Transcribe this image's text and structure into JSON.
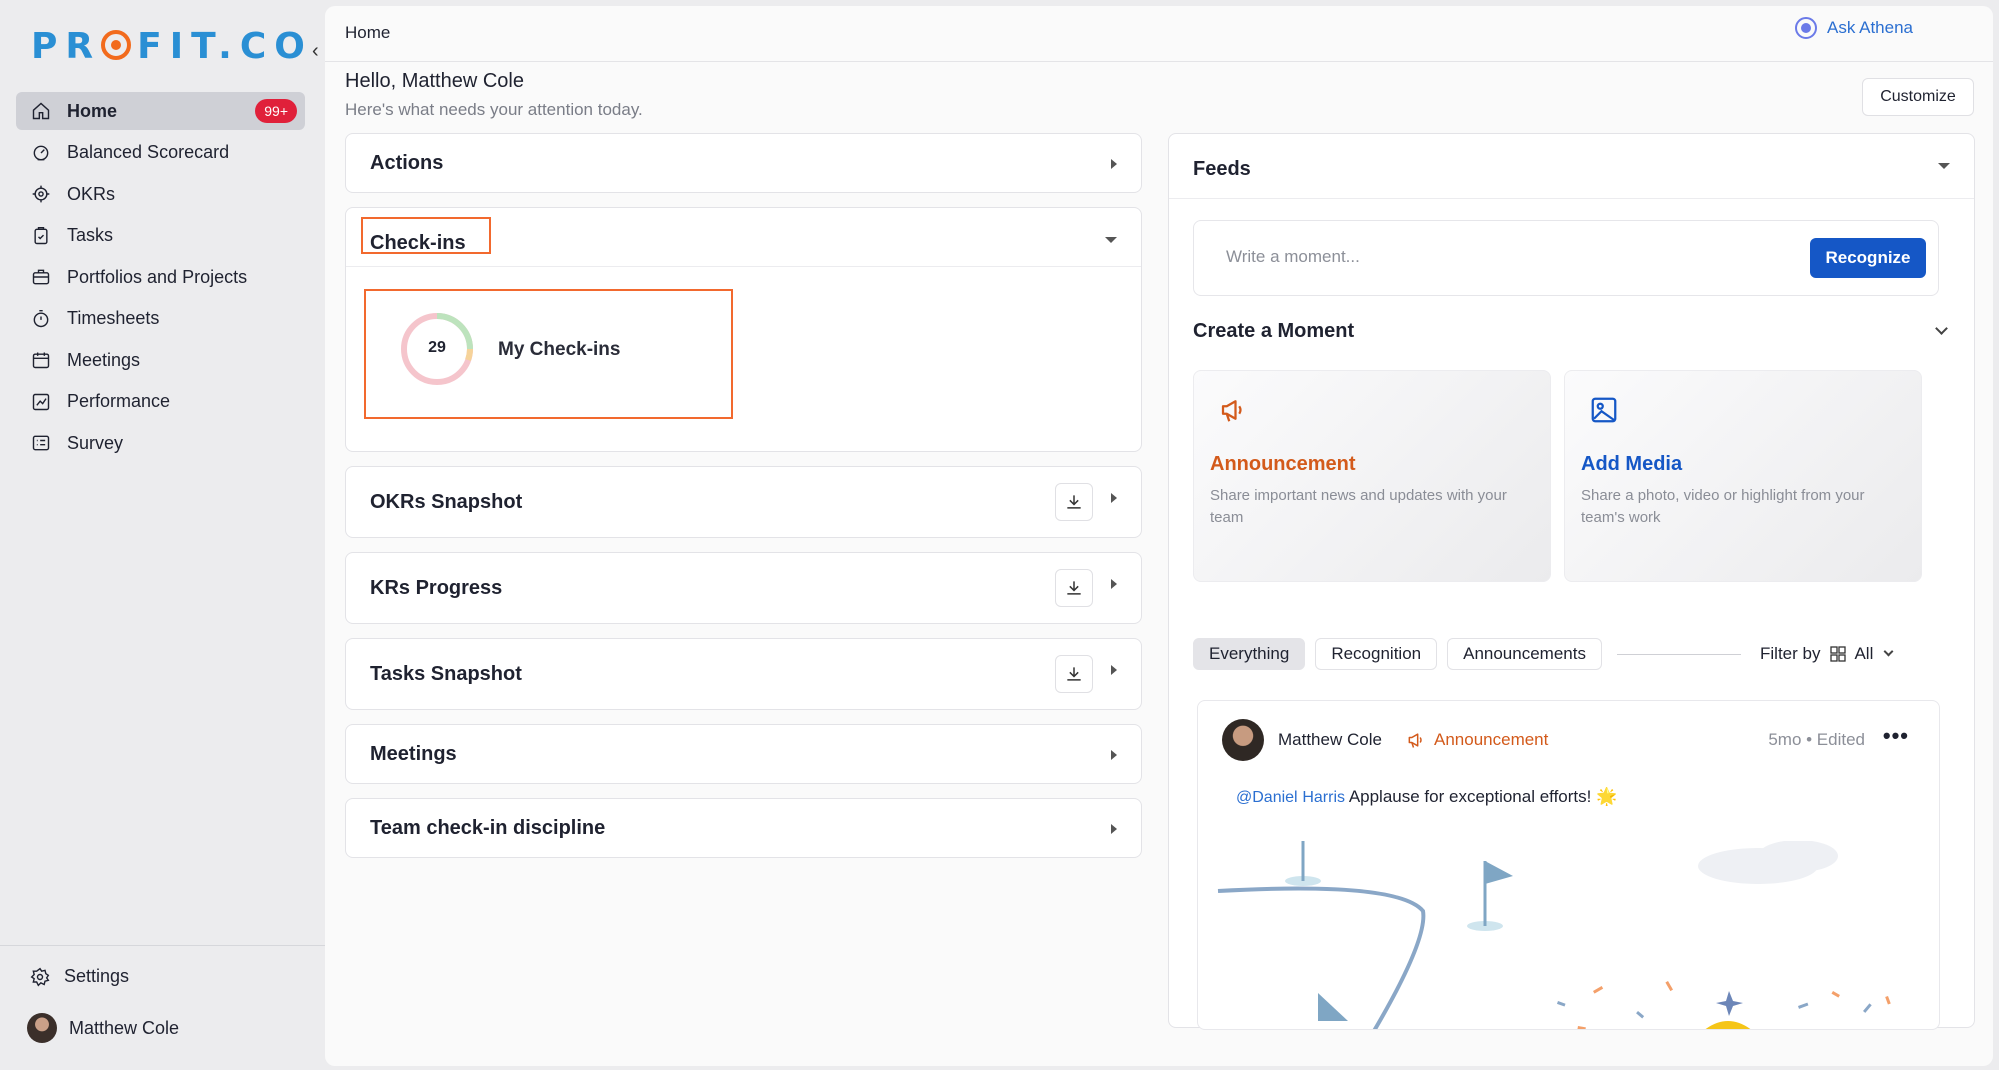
{
  "brand": {
    "logo_text_1": "PR",
    "logo_text_2": "FIT.CO"
  },
  "sidebar": {
    "items": [
      {
        "label": "Home",
        "icon": "home-icon",
        "badge": "99+"
      },
      {
        "label": "Balanced Scorecard",
        "icon": "scorecard-icon"
      },
      {
        "label": "OKRs",
        "icon": "target-icon"
      },
      {
        "label": "Tasks",
        "icon": "clipboard-icon"
      },
      {
        "label": "Portfolios and Projects",
        "icon": "briefcase-icon"
      },
      {
        "label": "Timesheets",
        "icon": "stopwatch-icon"
      },
      {
        "label": "Meetings",
        "icon": "calendar-icon"
      },
      {
        "label": "Performance",
        "icon": "chart-icon"
      },
      {
        "label": "Survey",
        "icon": "survey-icon"
      }
    ],
    "settings_label": "Settings",
    "user_name": "Matthew Cole"
  },
  "header": {
    "breadcrumb": "Home",
    "ask_label": "Ask Athena",
    "greeting": "Hello, Matthew Cole",
    "subtitle": "Here's what needs your attention today.",
    "customize_label": "Customize"
  },
  "widgets": {
    "actions": "Actions",
    "checkins": "Check-ins",
    "my_checkins_count": "29",
    "my_checkins_label": "My Check-ins",
    "okrs_snapshot": "OKRs Snapshot",
    "krs_progress": "KRs Progress",
    "tasks_snapshot": "Tasks Snapshot",
    "meetings": "Meetings",
    "team_discipline": "Team check-in discipline"
  },
  "feeds": {
    "title": "Feeds",
    "input_placeholder": "Write a moment...",
    "recognize_label": "Recognize",
    "create_moment": "Create a Moment",
    "announcement": {
      "title": "Announcement",
      "desc": "Share important news and updates with your team"
    },
    "add_media": {
      "title": "Add Media",
      "desc": "Share a photo, video or highlight from your team's work"
    },
    "tabs": [
      "Everything",
      "Recognition",
      "Announcements"
    ],
    "filter_label": "Filter by",
    "filter_value": "All",
    "post": {
      "author": "Matthew Cole",
      "type": "Announcement",
      "time": "5mo • Edited",
      "mention_1": "@Daniel",
      "mention_2": "Harris",
      "text": "Applause for exceptional efforts! 🌟"
    }
  },
  "colors": {
    "accent": "#1557c6",
    "brand_blue": "#2a8fd4",
    "brand_orange": "#f26b1d",
    "highlight": "#f2692e",
    "badge": "#e0203a"
  }
}
